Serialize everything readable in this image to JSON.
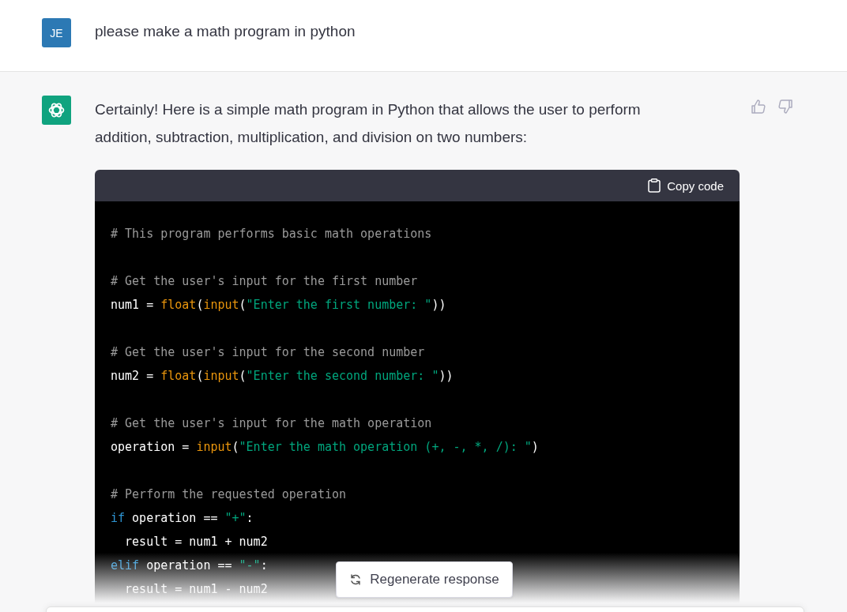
{
  "user_message": {
    "avatar": "JE",
    "text": "please make a math program in python"
  },
  "assistant_message": {
    "text": "Certainly! Here is a simple math program in Python that allows the user to perform addition, subtraction, multiplication, and division on two numbers:",
    "code_block": {
      "copy_label": "Copy code",
      "lines": [
        {
          "kind": "code",
          "tokens": [
            {
              "kind": "comment",
              "text": "# This program performs basic math operations"
            }
          ]
        },
        {
          "kind": "blank"
        },
        {
          "kind": "code",
          "tokens": [
            {
              "kind": "comment",
              "text": "# Get the user's input for the first number"
            }
          ]
        },
        {
          "kind": "code",
          "tokens": [
            {
              "kind": "plain",
              "text": "num1 = "
            },
            {
              "kind": "func",
              "text": "float"
            },
            {
              "kind": "plain",
              "text": "("
            },
            {
              "kind": "func",
              "text": "input"
            },
            {
              "kind": "plain",
              "text": "("
            },
            {
              "kind": "string",
              "text": "\"Enter the first number: \""
            },
            {
              "kind": "plain",
              "text": "))"
            }
          ]
        },
        {
          "kind": "blank"
        },
        {
          "kind": "code",
          "tokens": [
            {
              "kind": "comment",
              "text": "# Get the user's input for the second number"
            }
          ]
        },
        {
          "kind": "code",
          "tokens": [
            {
              "kind": "plain",
              "text": "num2 = "
            },
            {
              "kind": "func",
              "text": "float"
            },
            {
              "kind": "plain",
              "text": "("
            },
            {
              "kind": "func",
              "text": "input"
            },
            {
              "kind": "plain",
              "text": "("
            },
            {
              "kind": "string",
              "text": "\"Enter the second number: \""
            },
            {
              "kind": "plain",
              "text": "))"
            }
          ]
        },
        {
          "kind": "blank"
        },
        {
          "kind": "code",
          "tokens": [
            {
              "kind": "comment",
              "text": "# Get the user's input for the math operation"
            }
          ]
        },
        {
          "kind": "code",
          "tokens": [
            {
              "kind": "plain",
              "text": "operation = "
            },
            {
              "kind": "func",
              "text": "input"
            },
            {
              "kind": "plain",
              "text": "("
            },
            {
              "kind": "string",
              "text": "\"Enter the math operation (+, -, *, /): \""
            },
            {
              "kind": "plain",
              "text": ")"
            }
          ]
        },
        {
          "kind": "blank"
        },
        {
          "kind": "code",
          "tokens": [
            {
              "kind": "comment",
              "text": "# Perform the requested operation"
            }
          ]
        },
        {
          "kind": "code",
          "tokens": [
            {
              "kind": "keyword",
              "text": "if"
            },
            {
              "kind": "plain",
              "text": " operation == "
            },
            {
              "kind": "string",
              "text": "\"+\""
            },
            {
              "kind": "plain",
              "text": ":"
            }
          ]
        },
        {
          "kind": "code",
          "tokens": [
            {
              "kind": "plain",
              "text": "  result = num1 + num2"
            }
          ]
        },
        {
          "kind": "code",
          "tokens": [
            {
              "kind": "keyword",
              "text": "elif"
            },
            {
              "kind": "plain",
              "text": " operation == "
            },
            {
              "kind": "string",
              "text": "\"-\""
            },
            {
              "kind": "plain",
              "text": ":"
            }
          ]
        },
        {
          "kind": "code",
          "tokens": [
            {
              "kind": "plain",
              "text": "  result = num1 - num2"
            }
          ]
        }
      ]
    }
  },
  "regenerate_button": {
    "label": "Regenerate response"
  }
}
